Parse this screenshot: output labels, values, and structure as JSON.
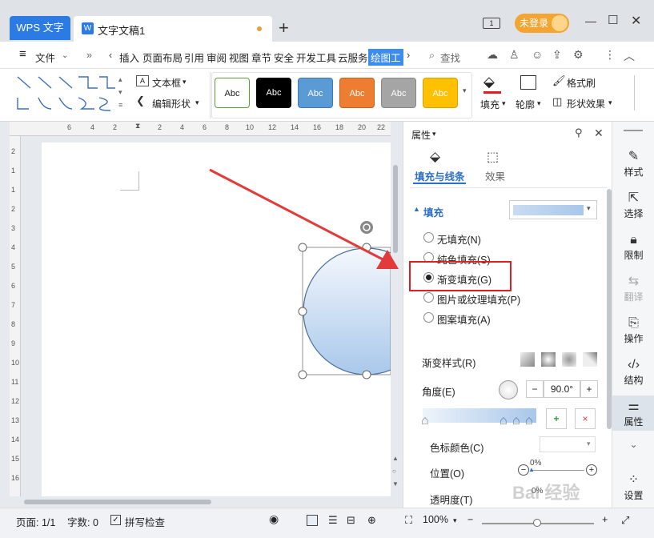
{
  "tabs": {
    "app": "WPS 文字",
    "doc_title": "文字文稿1",
    "doc_icon": "W"
  },
  "header": {
    "login": "未登录",
    "page_indicator": "1"
  },
  "menu": {
    "file": "文件",
    "items": [
      "插入",
      "页面布局",
      "引用",
      "审阅",
      "视图",
      "章节",
      "安全",
      "开发工具",
      "云服务",
      "绘图工"
    ],
    "search": "查找"
  },
  "ribbon": {
    "textbox": "文本框",
    "edit_shape": "编辑形状",
    "styles": [
      "Abc",
      "Abc",
      "Abc",
      "Abc",
      "Abc",
      "Abc"
    ],
    "fill": "填充",
    "outline": "轮廓",
    "format_brush": "格式刷",
    "shape_effects": "形状效果",
    "style_colors": [
      "#ffffff",
      "#000000",
      "#5b9bd5",
      "#ed7d31",
      "#a5a5a5",
      "#ffc000"
    ]
  },
  "panel": {
    "title": "属性",
    "tab_fill": "填充与线条",
    "tab_effect": "效果",
    "section_fill": "填充",
    "options": [
      "无填充(N)",
      "纯色填充(S)",
      "渐变填充(G)",
      "图片或纹理填充(P)",
      "图案填充(A)"
    ],
    "selected_option": 2,
    "gradient_style": "渐变样式(R)",
    "angle_label": "角度(E)",
    "angle_value": "90.0°",
    "stop_color": "色标颜色(C)",
    "position_label": "位置(O)",
    "position_value": "0%",
    "transparency_label": "透明度(T)",
    "transparency_value": "0%"
  },
  "rightbar": {
    "items": [
      "样式",
      "选择",
      "限制",
      "翻译",
      "操作",
      "结构",
      "属性",
      "设置"
    ]
  },
  "status": {
    "page": "页面: 1/1",
    "words": "字数: 0",
    "spell": "拼写检查",
    "zoom": "100%"
  },
  "ruler_h": [
    "6",
    "4",
    "2",
    "2",
    "4",
    "6",
    "8",
    "10",
    "12",
    "14",
    "16",
    "18",
    "20",
    "22"
  ],
  "ruler_v": [
    "2",
    "1",
    "1",
    "2",
    "3",
    "4",
    "5",
    "6",
    "7",
    "8",
    "9",
    "10",
    "11",
    "12",
    "13",
    "14",
    "15",
    "16"
  ],
  "watermark": "Bai 经验"
}
